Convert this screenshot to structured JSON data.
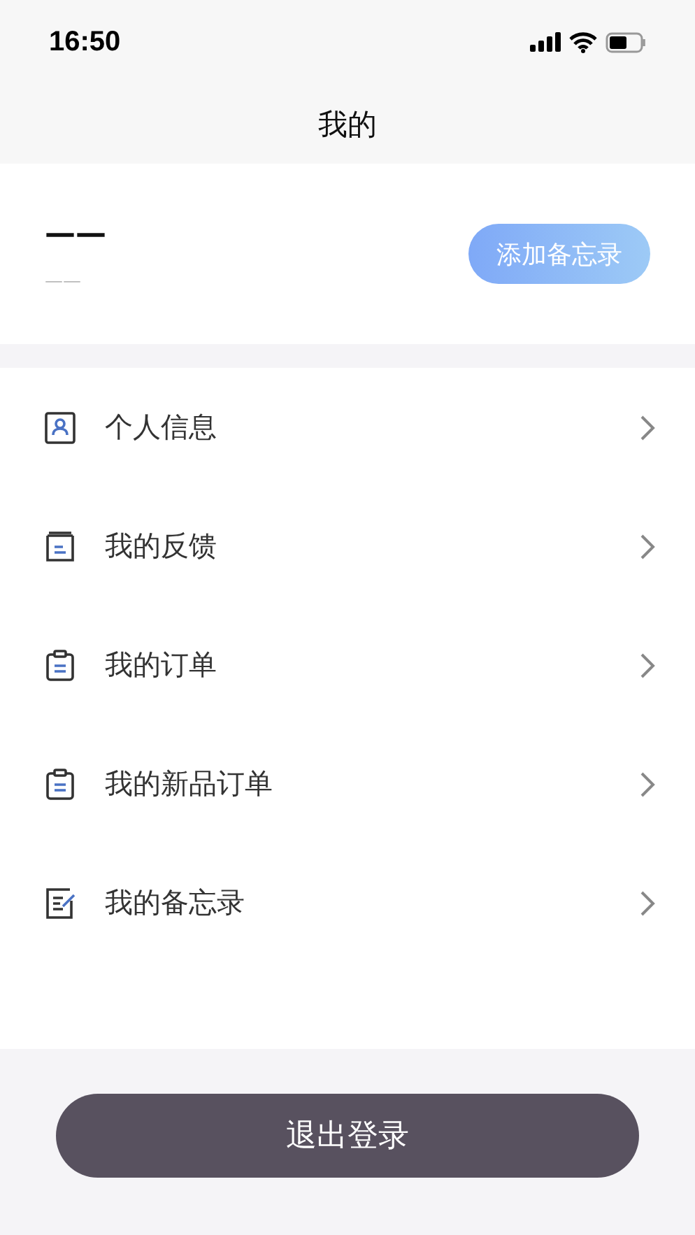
{
  "status_bar": {
    "time": "16:50"
  },
  "header": {
    "title": "我的"
  },
  "profile": {
    "name": "——",
    "subtitle": "——",
    "button": "添加备忘录"
  },
  "menu": [
    {
      "kind": "profile",
      "label": "个人信息"
    },
    {
      "kind": "feedback",
      "label": "我的反馈"
    },
    {
      "kind": "order",
      "label": "我的订单"
    },
    {
      "kind": "order",
      "label": "我的新品订单"
    },
    {
      "kind": "memo",
      "label": "我的备忘录"
    }
  ],
  "logout_button": "退出登录"
}
